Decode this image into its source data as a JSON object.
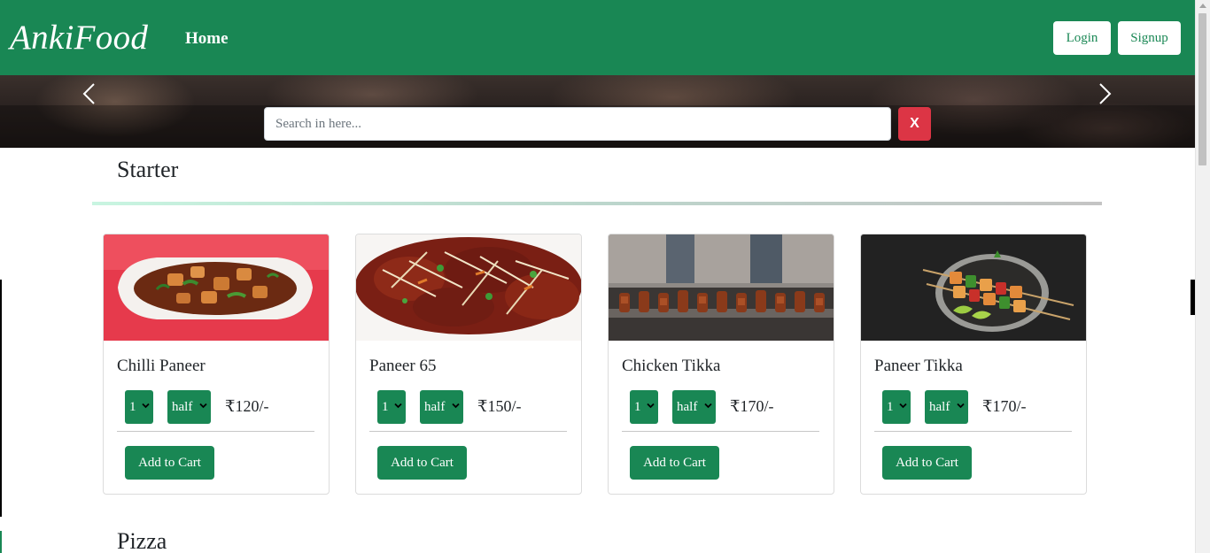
{
  "navbar": {
    "brand": "AnkiFood",
    "home_label": "Home",
    "login_label": "Login",
    "signup_label": "Signup",
    "accent_color": "#198754"
  },
  "hero": {
    "search_placeholder": "Search in here...",
    "search_value": "",
    "clear_label": "X",
    "prev_icon": "chevron-left-icon",
    "next_icon": "chevron-right-icon"
  },
  "sections": [
    {
      "title": "Starter",
      "items": [
        {
          "name": "Chilli Paneer",
          "qty": "1",
          "size": "half",
          "price": "₹120/-",
          "button": "Add to Cart",
          "image": "chilli-paneer-image"
        },
        {
          "name": "Paneer 65",
          "qty": "1",
          "size": "half",
          "price": "₹150/-",
          "button": "Add to Cart",
          "image": "paneer-65-image"
        },
        {
          "name": "Chicken Tikka",
          "qty": "1",
          "size": "half",
          "price": "₹170/-",
          "button": "Add to Cart",
          "image": "chicken-tikka-image"
        },
        {
          "name": "Paneer Tikka",
          "qty": "1",
          "size": "half",
          "price": "₹170/-",
          "button": "Add to Cart",
          "image": "paneer-tikka-image"
        }
      ]
    },
    {
      "title": "Pizza",
      "items": []
    }
  ],
  "colors": {
    "primary": "#198754",
    "danger": "#dc3545"
  }
}
